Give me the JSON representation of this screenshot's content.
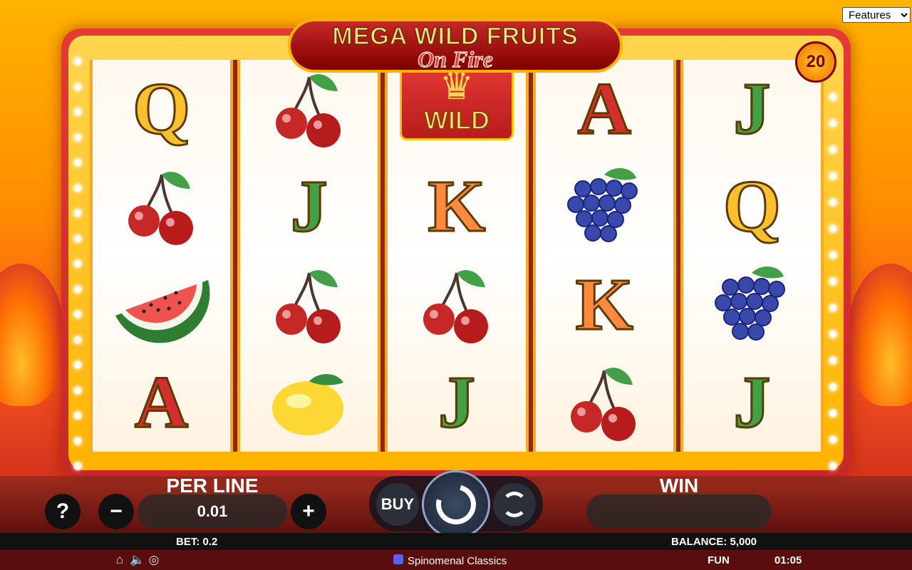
{
  "features_select": {
    "value": "Features",
    "options": [
      "Features"
    ]
  },
  "logo": {
    "line1": "MEGA WILD FRUITS",
    "line2": "On Fire"
  },
  "lines_count": "20",
  "reels": [
    [
      "Q",
      "cherry",
      "watermelon",
      "A"
    ],
    [
      "cherry",
      "J",
      "cherry",
      "lemon"
    ],
    [
      "wild",
      "K",
      "cherry",
      "J"
    ],
    [
      "A",
      "grapes",
      "K",
      "cherry"
    ],
    [
      "J",
      "Q",
      "grapes",
      "J"
    ]
  ],
  "wild_label": "WILD",
  "controls": {
    "help": "?",
    "minus": "−",
    "plus": "+",
    "per_line_label": "PER LINE",
    "per_line_value": "0.01",
    "buy_label": "BUY",
    "win_label": "WIN",
    "win_value": ""
  },
  "info": {
    "bet": "BET: 0.2",
    "balance": "BALANCE: 5,000"
  },
  "footer": {
    "brand": "Spinomenal Classics",
    "mode": "FUN",
    "clock": "01:05"
  },
  "icons": [
    "home-icon",
    "sound-icon",
    "turbo-icon",
    "spin-icon",
    "autoplay-icon",
    "spinomenal-logo-icon"
  ],
  "colors": {
    "accent": "#ffb300",
    "frame": "#c62828",
    "footer": "#5a0d0d"
  }
}
